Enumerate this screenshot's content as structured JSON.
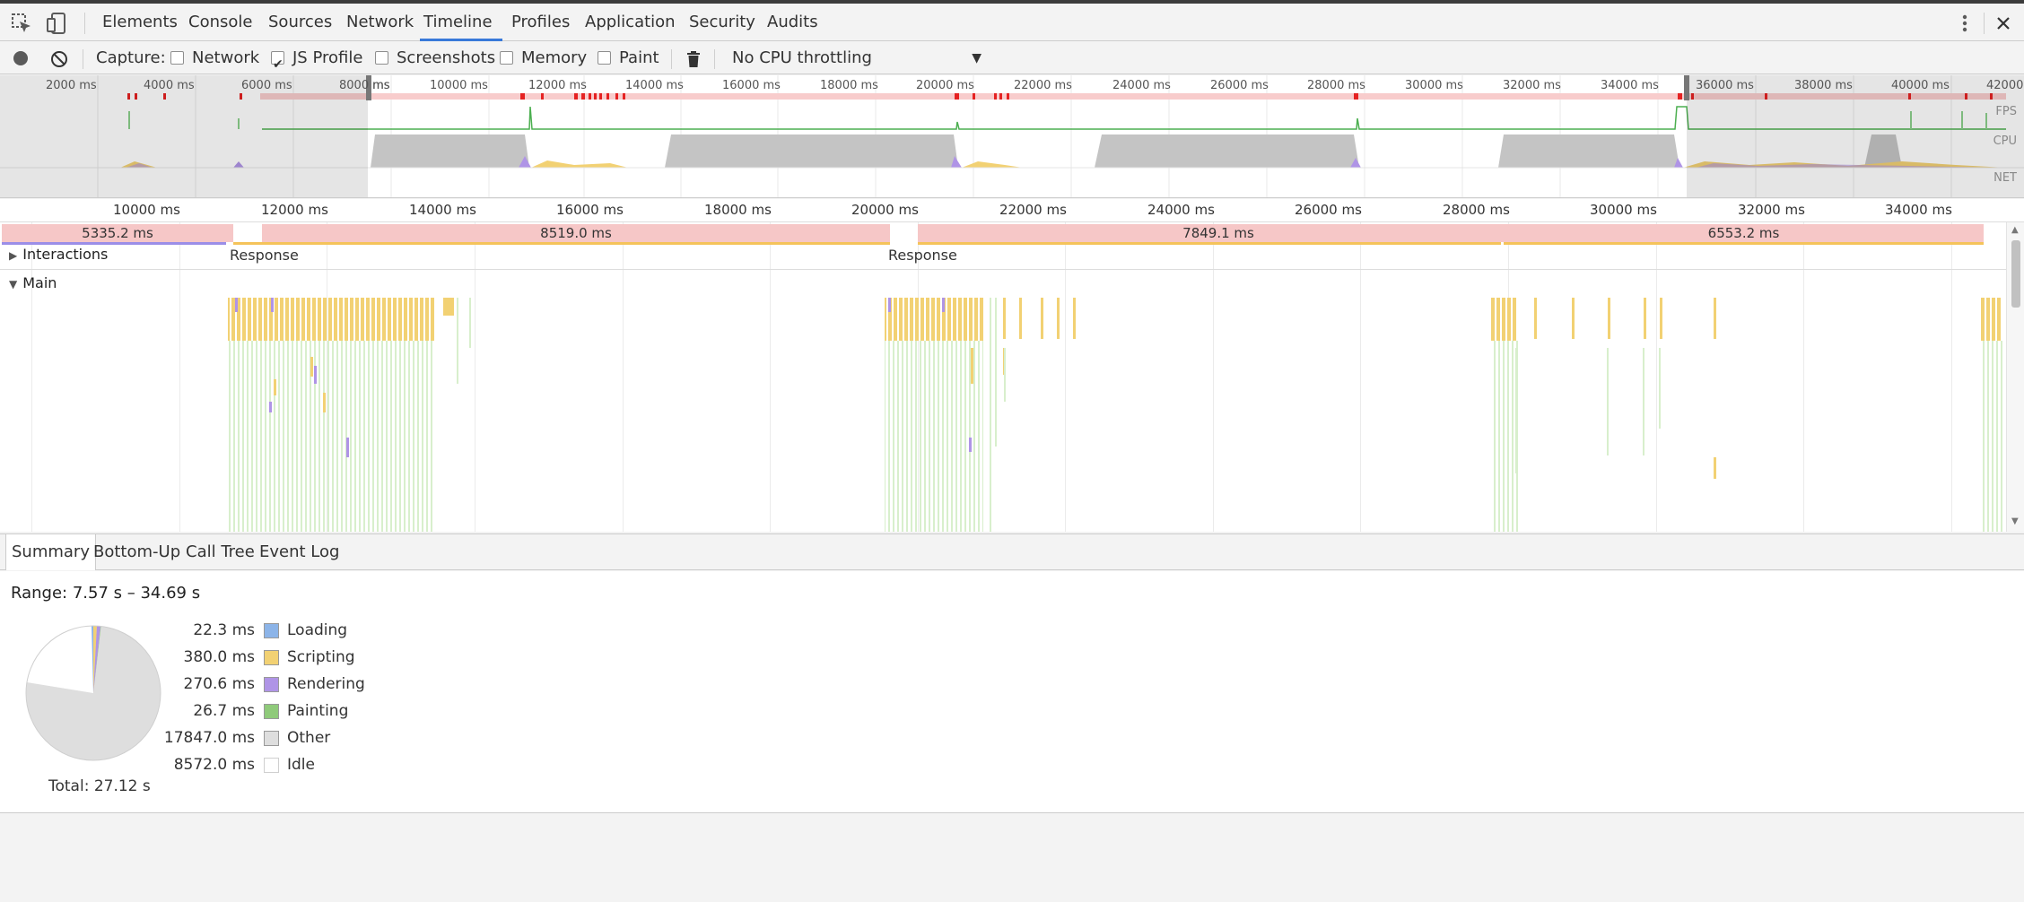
{
  "tabs": [
    "Elements",
    "Console",
    "Sources",
    "Network",
    "Timeline",
    "Profiles",
    "Application",
    "Security",
    "Audits"
  ],
  "active_tab": "Timeline",
  "toolbar": {
    "capture_label": "Capture:",
    "network_label": "Network",
    "jsprofile_label": "JS Profile",
    "screenshots_label": "Screenshots",
    "memory_label": "Memory",
    "paint_label": "Paint",
    "throttling_value": "No CPU throttling"
  },
  "overview": {
    "tick_labels": [
      "2000 ms",
      "4000 ms",
      "6000 ms",
      "8000 ms",
      "10000 ms",
      "12000 ms",
      "14000 ms",
      "16000 ms",
      "18000 ms",
      "20000 ms",
      "22000 ms",
      "24000 ms",
      "26000 ms",
      "28000 ms",
      "30000 ms",
      "32000 ms",
      "34000 ms",
      "36000 ms",
      "38000 ms",
      "40000 ms",
      "42000"
    ],
    "tracks": [
      "FPS",
      "CPU",
      "NET"
    ],
    "partial_label": "ms"
  },
  "ruler": {
    "labels": [
      "10000 ms",
      "12000 ms",
      "14000 ms",
      "16000 ms",
      "18000 ms",
      "20000 ms",
      "22000 ms",
      "24000 ms",
      "26000 ms",
      "28000 ms",
      "30000 ms",
      "32000 ms",
      "34000 ms"
    ]
  },
  "frames": [
    "5335.2 ms",
    "8519.0 ms",
    "7849.1 ms",
    "6553.2 ms"
  ],
  "rows": {
    "interactions": "Interactions",
    "response_1": "Response",
    "response_2": "Response",
    "main": "Main"
  },
  "bottom_tabs": [
    "Summary",
    "Bottom-Up",
    "Call Tree",
    "Event Log"
  ],
  "summary": {
    "range": "Range: 7.57 s – 34.69 s",
    "total": "Total: 27.12 s",
    "legend": [
      {
        "value": "22.3 ms",
        "name": "Loading",
        "color": "#8cb4e8"
      },
      {
        "value": "380.0 ms",
        "name": "Scripting",
        "color": "#f2d173"
      },
      {
        "value": "270.6 ms",
        "name": "Rendering",
        "color": "#af94e6"
      },
      {
        "value": "26.7 ms",
        "name": "Painting",
        "color": "#8fca7a"
      },
      {
        "value": "17847.0 ms",
        "name": "Other",
        "color": "#dedede"
      },
      {
        "value": "8572.0 ms",
        "name": "Idle",
        "color": "#ffffff"
      }
    ]
  }
}
